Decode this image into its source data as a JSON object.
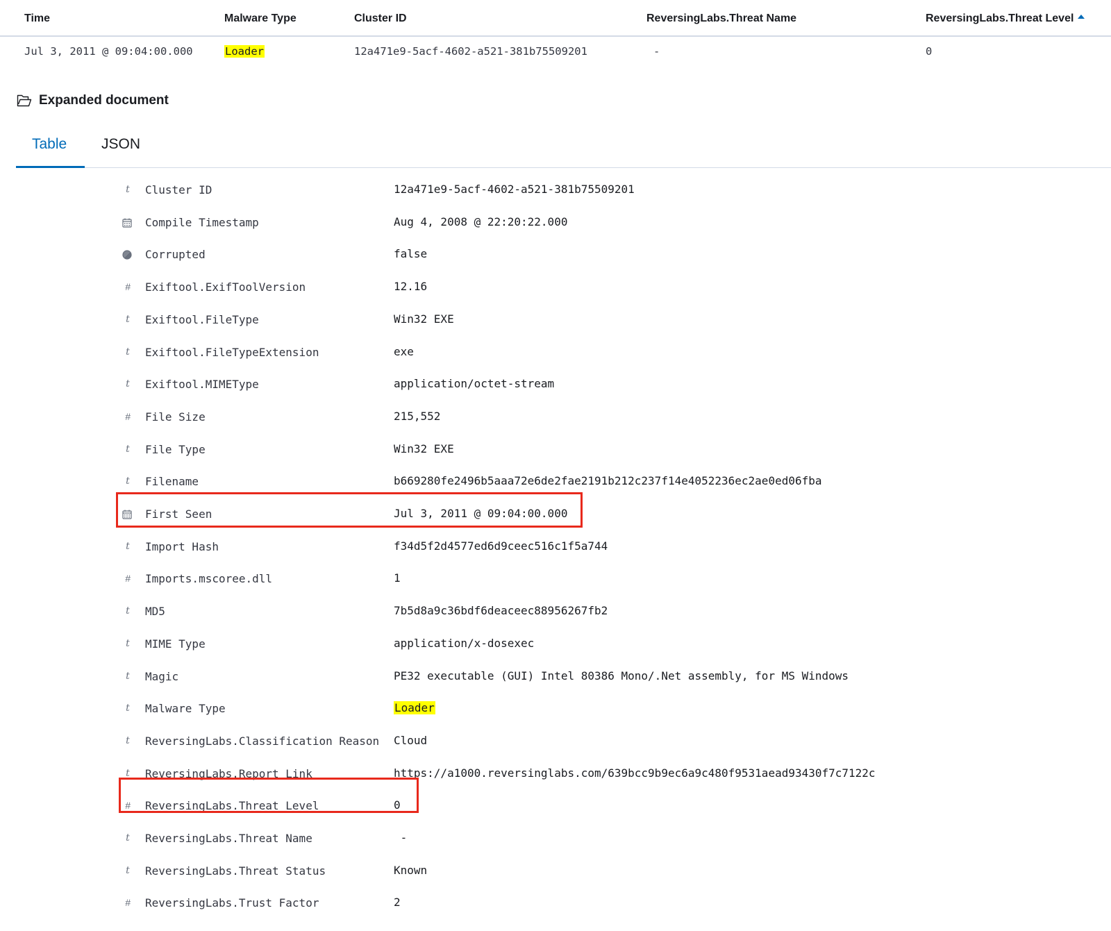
{
  "results_table": {
    "columns": [
      {
        "label": "Time"
      },
      {
        "label": "Malware Type"
      },
      {
        "label": "Cluster ID"
      },
      {
        "label": "ReversingLabs.Threat Name"
      },
      {
        "label": "ReversingLabs.Threat Level",
        "sort": "ascending",
        "sort_icon": "sort-ascending-icon"
      }
    ],
    "rows": [
      {
        "time": "Jul 3, 2011 @ 09:04:00.000",
        "malware_type": "Loader",
        "cluster_id": "12a471e9-5acf-4602-a521-381b75509201",
        "threat_name": "-",
        "threat_level": "0"
      }
    ]
  },
  "expanded_document": {
    "title": "Expanded document",
    "icon": "folder-icon",
    "tabs": [
      {
        "label": "Table",
        "active": true
      },
      {
        "label": "JSON",
        "active": false
      }
    ],
    "fields": [
      {
        "type": "t",
        "name": "Cluster ID",
        "value": "12a471e9-5acf-4602-a521-381b75509201"
      },
      {
        "type": "date",
        "name": "Compile Timestamp",
        "value": "Aug 4, 2008 @ 22:20:22.000"
      },
      {
        "type": "bool",
        "name": "Corrupted",
        "value": "false"
      },
      {
        "type": "#",
        "name": "Exiftool.ExifToolVersion",
        "value": "12.16"
      },
      {
        "type": "t",
        "name": "Exiftool.FileType",
        "value": "Win32 EXE"
      },
      {
        "type": "t",
        "name": "Exiftool.FileTypeExtension",
        "value": "exe"
      },
      {
        "type": "t",
        "name": "Exiftool.MIMEType",
        "value": "application/octet-stream"
      },
      {
        "type": "#",
        "name": "File Size",
        "value": "215,552"
      },
      {
        "type": "t",
        "name": "File Type",
        "value": "Win32 EXE"
      },
      {
        "type": "t",
        "name": "Filename",
        "value": "b669280fe2496b5aaa72e6de2fae2191b212c237f14e4052236ec2ae0ed06fba"
      },
      {
        "type": "date",
        "name": "First Seen",
        "value": "Jul 3, 2011 @ 09:04:00.000",
        "highlighted_box": true
      },
      {
        "type": "t",
        "name": "Import Hash",
        "value": "f34d5f2d4577ed6d9ceec516c1f5a744"
      },
      {
        "type": "#",
        "name": "Imports.mscoree.dll",
        "value": "1"
      },
      {
        "type": "t",
        "name": "MD5",
        "value": "7b5d8a9c36bdf6deaceec88956267fb2"
      },
      {
        "type": "t",
        "name": "MIME Type",
        "value": "application/x-dosexec"
      },
      {
        "type": "t",
        "name": "Magic",
        "value": "PE32 executable (GUI) Intel 80386 Mono/.Net assembly, for MS Windows"
      },
      {
        "type": "t",
        "name": "Malware Type",
        "value": "Loader",
        "value_highlight": true
      },
      {
        "type": "t",
        "name": "ReversingLabs.Classification Reason",
        "value": "Cloud"
      },
      {
        "type": "t",
        "name": "ReversingLabs.Report Link",
        "value": "https://a1000.reversinglabs.com/639bcc9b9ec6a9c480f9531aead93430f7c7122c"
      },
      {
        "type": "#",
        "name": "ReversingLabs.Threat Level",
        "value": "0",
        "highlighted_box": true
      },
      {
        "type": "t",
        "name": "ReversingLabs.Threat Name",
        "value": " -"
      },
      {
        "type": "t",
        "name": "ReversingLabs.Threat Status",
        "value": "Known"
      },
      {
        "type": "#",
        "name": "ReversingLabs.Trust Factor",
        "value": "2"
      }
    ]
  },
  "colors": {
    "accent": "#006bb8",
    "highlight": "#ffff00",
    "annotation_box": "#e8291c",
    "text_primary": "#1a1c21",
    "text_secondary": "#343741",
    "icon_gray": "#69707d",
    "border": "#d3dae6"
  }
}
